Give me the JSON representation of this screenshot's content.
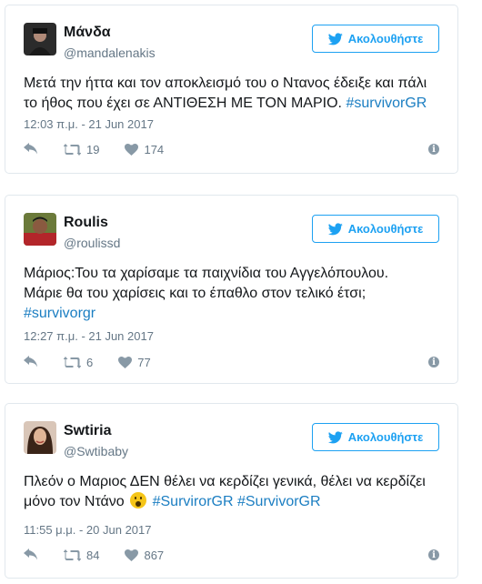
{
  "follow_label": "Ακολουθήστε",
  "tweets": [
    {
      "name": "Μάνδα",
      "handle": "@mandalenakis",
      "text_plain": "Μετά την ήττα και τον αποκλεισμό του ο Ντανος έδειξε και πάλι το ήθος που έχει σε ΑΝΤΙΘΕΣΗ ΜΕ ΤΟΝ ΜΑΡΙΟ.",
      "hashtags": [
        "#survivorGR"
      ],
      "time": "12:03 π.μ. - 21 Jun 2017",
      "retweets": "19",
      "likes": "174"
    },
    {
      "name": "Roulis",
      "handle": "@roulissd",
      "text_line1": "Μάριος:Του τα χαρίσαμε τα παιχνίδια του Αγγελόπουλου.",
      "text_line2": "Μάριε θα του χαρίσεις και το έπαθλο στον τελικό έτσι;",
      "hashtags": [
        "#survivorgr"
      ],
      "time": "12:27 π.μ. - 21 Jun 2017",
      "retweets": "6",
      "likes": "77"
    },
    {
      "name": "Swtiria",
      "handle": "@Swtibaby",
      "text_plain": "Πλεόν ο Μαριος ΔΕΝ θέλει να κερδίζει γενικά, θέλει να κερδίζει μόνο τον Ντάνο",
      "hashtags": [
        "#SurvirorGR",
        "#SurvivorGR"
      ],
      "time": "11:55 μ.μ. - 20 Jun 2017",
      "retweets": "84",
      "likes": "867"
    }
  ],
  "icons": {
    "follow": "twitter-bird-icon",
    "reply": "reply-icon",
    "retweet": "retweet-icon",
    "like": "heart-icon",
    "info": "info-icon"
  },
  "colors": {
    "accent": "#1da1f2",
    "hashtag": "#1b7ec2",
    "muted": "#657786",
    "border": "#e1e8ed"
  }
}
